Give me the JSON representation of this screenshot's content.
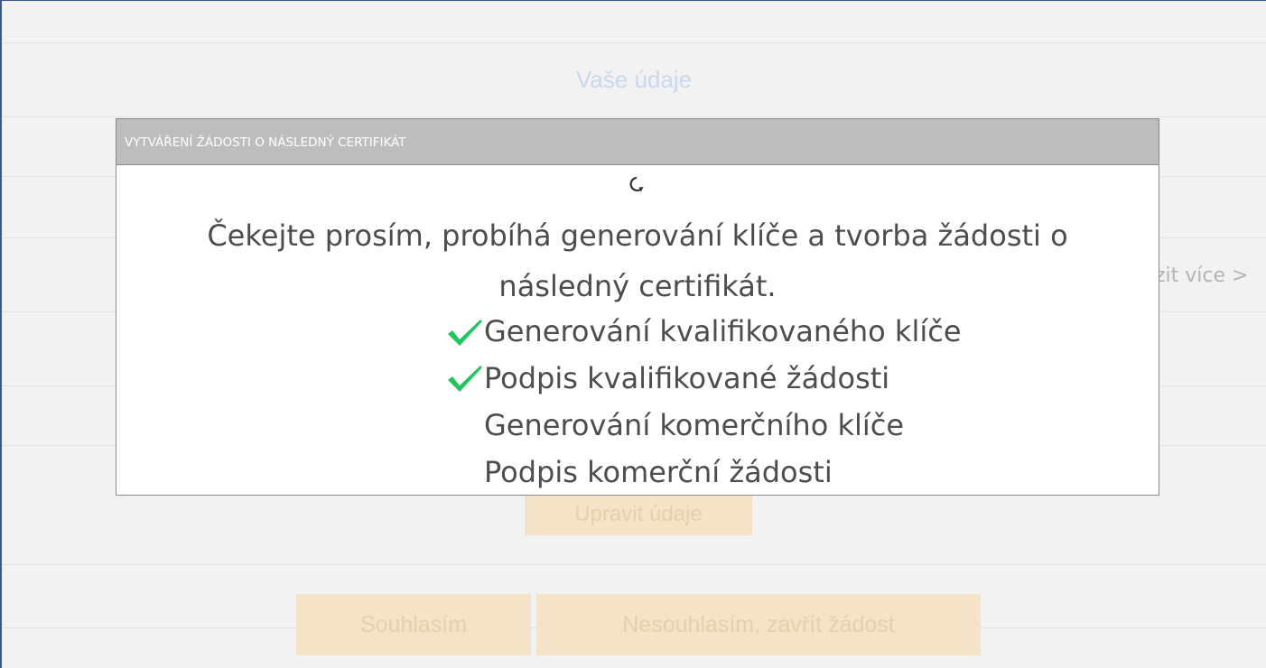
{
  "page": {
    "title": "Vaše údaje",
    "more_link": "zit více >"
  },
  "buttons": {
    "edit": "Upravit údaje",
    "agree": "Souhlasím",
    "disagree": "Nesouhlasím, zavřít žádost"
  },
  "modal": {
    "header": "VYTVÁŘENÍ ŽÁDOSTI O NÁSLEDNÝ CERTIFIKÁT",
    "spinner_icon": "loading-spinner-icon",
    "message_line1": "Čekejte prosím, probíhá generování klíče a tvorba žádosti o",
    "message_line2": "následný certifikát.",
    "steps": [
      {
        "label": "Generování kvalifikovaného klíče",
        "done": true
      },
      {
        "label": "Podpis kvalifikované žádosti",
        "done": true
      },
      {
        "label": "Generování komerčního klíče",
        "done": false
      },
      {
        "label": "Podpis komerční žádosti",
        "done": false
      }
    ]
  },
  "colors": {
    "check": "#22c55e",
    "modal_header_bg": "#bdbdbd",
    "page_bg": "#f2f2f2",
    "button_bg": "#f4e3c6"
  }
}
